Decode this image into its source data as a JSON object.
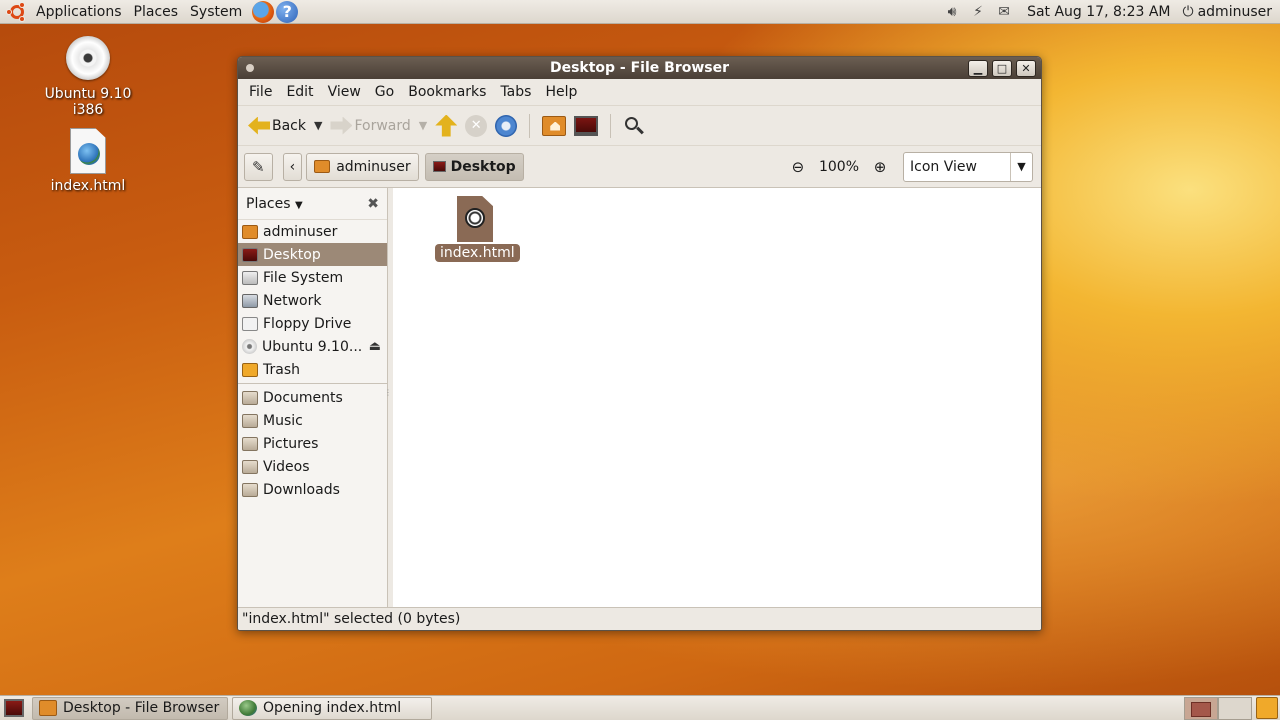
{
  "top_panel": {
    "menus": [
      "Applications",
      "Places",
      "System"
    ],
    "launchers": [
      "firefox-icon",
      "help-icon"
    ],
    "clock": "Sat Aug 17,  8:23 AM",
    "user": "adminuser",
    "tray_icons": [
      "volume-icon",
      "network-icon",
      "mail-icon"
    ]
  },
  "desktop": {
    "icons": [
      {
        "label": "Ubuntu 9.10 i386",
        "icon": "cd-icon"
      },
      {
        "label": "index.html",
        "icon": "html-file-icon"
      }
    ]
  },
  "window": {
    "title": "Desktop - File Browser",
    "menubar": [
      {
        "label": "File"
      },
      {
        "label": "Edit"
      },
      {
        "label": "View"
      },
      {
        "label": "Go"
      },
      {
        "label": "Bookmarks"
      },
      {
        "label": "Tabs"
      },
      {
        "label": "Help"
      }
    ],
    "toolbar": {
      "back": "Back",
      "forward": "Forward"
    },
    "location": {
      "crumbs": [
        "adminuser",
        "Desktop"
      ],
      "zoom": "100%",
      "view_mode": "Icon View"
    },
    "sidebar": {
      "header": "Places",
      "places": [
        {
          "label": "adminuser",
          "icon": "home-folder-icon"
        },
        {
          "label": "Desktop",
          "icon": "desktop-icon",
          "selected": true
        },
        {
          "label": "File System",
          "icon": "filesystem-icon"
        },
        {
          "label": "Network",
          "icon": "network-icon"
        },
        {
          "label": "Floppy Drive",
          "icon": "floppy-icon"
        },
        {
          "label": "Ubuntu 9.10...",
          "icon": "cd-icon",
          "eject": true
        },
        {
          "label": "Trash",
          "icon": "trash-icon"
        }
      ],
      "bookmarks": [
        {
          "label": "Documents",
          "icon": "folder-icon"
        },
        {
          "label": "Music",
          "icon": "folder-icon"
        },
        {
          "label": "Pictures",
          "icon": "folder-icon"
        },
        {
          "label": "Videos",
          "icon": "folder-icon"
        },
        {
          "label": "Downloads",
          "icon": "folder-icon"
        }
      ]
    },
    "files": [
      {
        "label": "index.html",
        "selected": true
      }
    ],
    "status": "\"index.html\" selected (0 bytes)"
  },
  "bottom_panel": {
    "tasks": [
      {
        "label": "Desktop - File Browser",
        "active": true
      },
      {
        "label": "Opening index.html",
        "active": false
      }
    ]
  }
}
